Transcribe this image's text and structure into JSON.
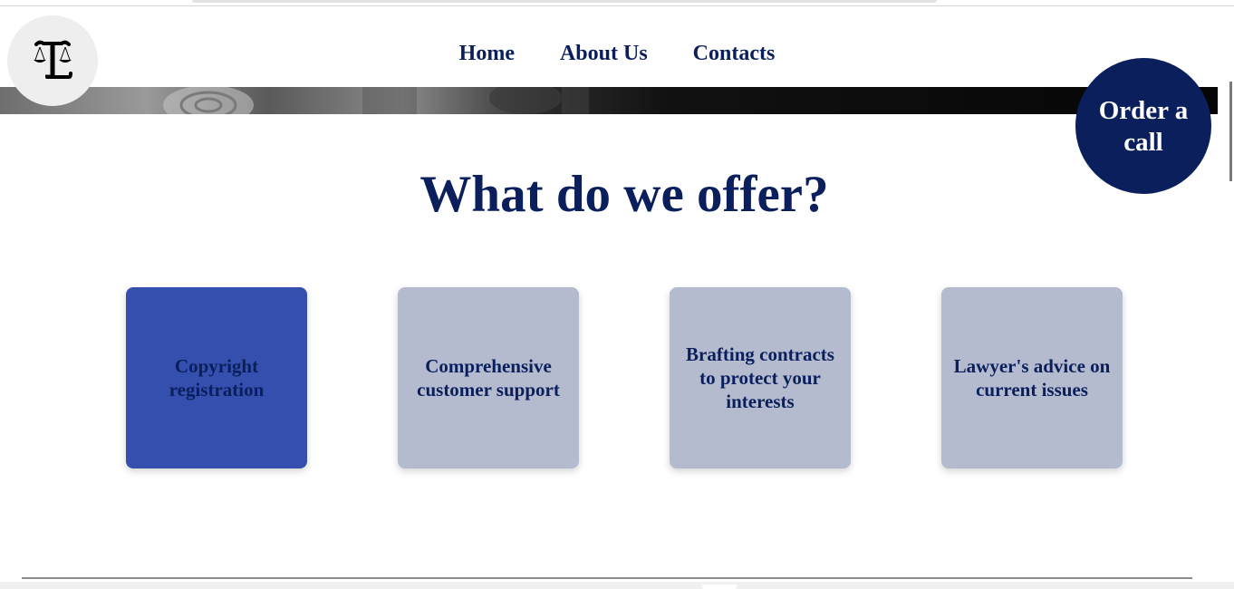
{
  "nav": {
    "items": [
      {
        "label": "Home"
      },
      {
        "label": "About Us"
      },
      {
        "label": "Contacts"
      }
    ]
  },
  "order_call": {
    "label": "Order a call"
  },
  "section": {
    "title": "What do we offer?"
  },
  "services": [
    {
      "label": "Copyright registration",
      "active": true
    },
    {
      "label": "Comprehensive customer support",
      "active": false
    },
    {
      "label": "Brafting contracts to protect your interests",
      "active": false
    },
    {
      "label": "Lawyer's advice on current issues",
      "active": false
    }
  ],
  "colors": {
    "brand_navy": "#0a1f5c",
    "card_active": "#344fae",
    "card_inactive": "#b4bbcf",
    "logo_bg": "#eeeeee"
  },
  "icons": {
    "logo": "scales-of-justice-logo"
  }
}
